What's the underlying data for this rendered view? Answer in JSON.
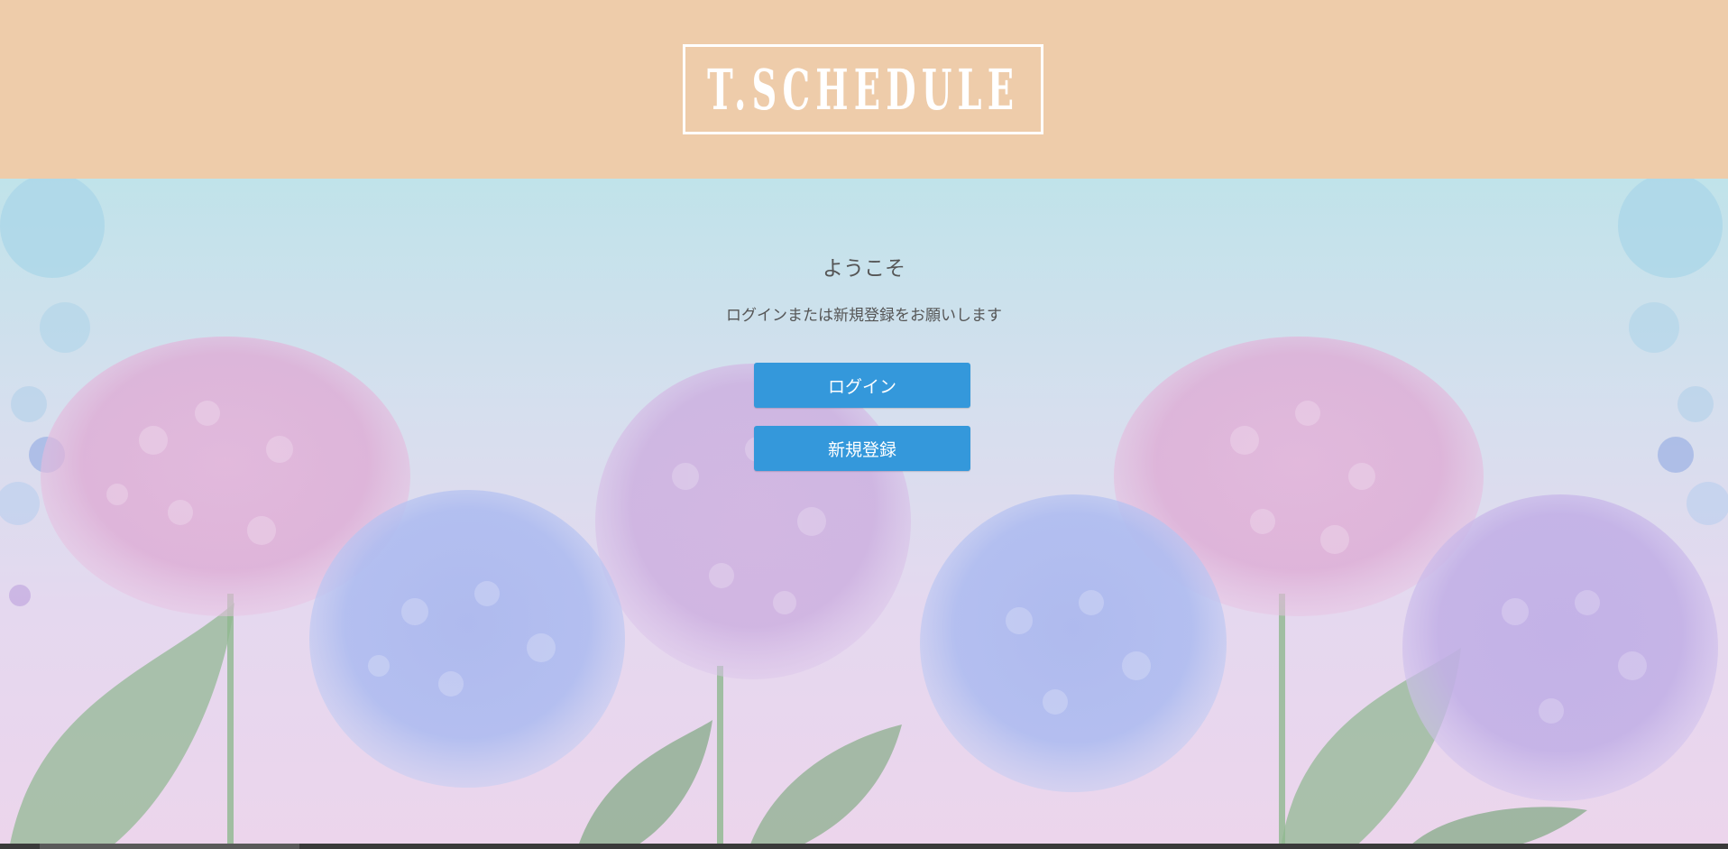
{
  "header": {
    "logo_text": "T.SCHEDULE",
    "background_color": "#eeccaa"
  },
  "main": {
    "welcome_title": "ようこそ",
    "subtitle": "ログインまたは新規登録をお願いします",
    "login_button_label": "ログイン",
    "register_button_label": "新規登録",
    "button_color": "#3498db",
    "background_art": "hydrangea-flowers-illustration"
  }
}
